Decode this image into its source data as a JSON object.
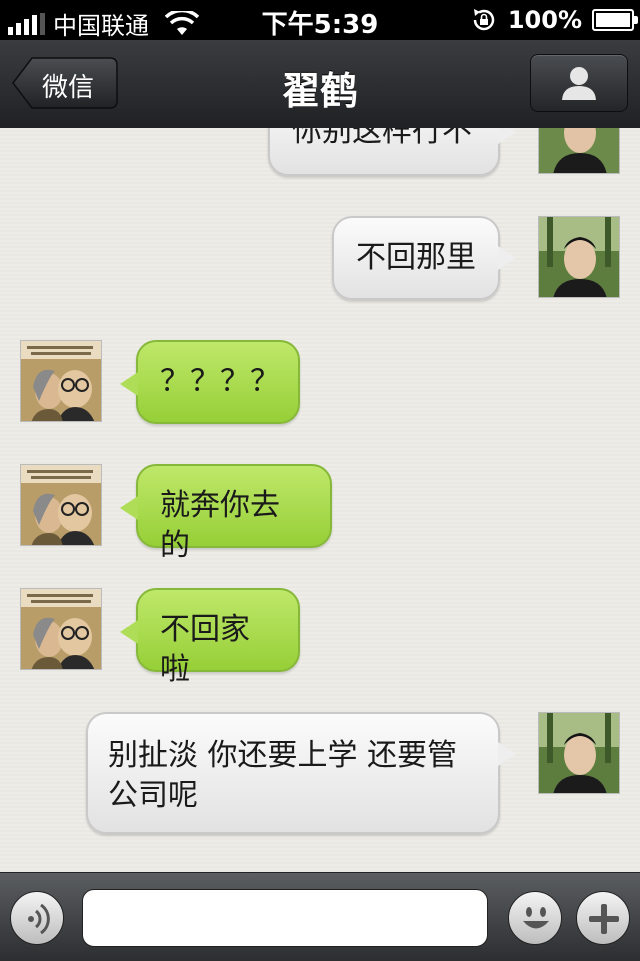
{
  "status_bar": {
    "carrier": "中国联通",
    "time": "下午5:39",
    "battery": "100%"
  },
  "nav": {
    "back_label": "微信",
    "title": "翟鹤"
  },
  "messages": [
    {
      "side": "out",
      "text": "你别这样行不"
    },
    {
      "side": "out",
      "text": "不回那里"
    },
    {
      "side": "in",
      "text": "？？？？"
    },
    {
      "side": "in",
      "text": "就奔你去的"
    },
    {
      "side": "in",
      "text": "不回家啦"
    },
    {
      "side": "out",
      "text": "别扯淡 你还要上学 还要管公司呢"
    }
  ],
  "input": {
    "value": "",
    "placeholder": ""
  },
  "icons": {
    "voice": "voice-icon",
    "emoji": "emoji-icon",
    "add": "plus-icon",
    "profile": "person-icon",
    "back": "back-arrow-icon"
  },
  "colors": {
    "outgoing_bubble": "#eeeeee",
    "incoming_bubble": "#afdd57",
    "nav_bar": "#2b2d2f",
    "chat_background": "#edece7"
  }
}
